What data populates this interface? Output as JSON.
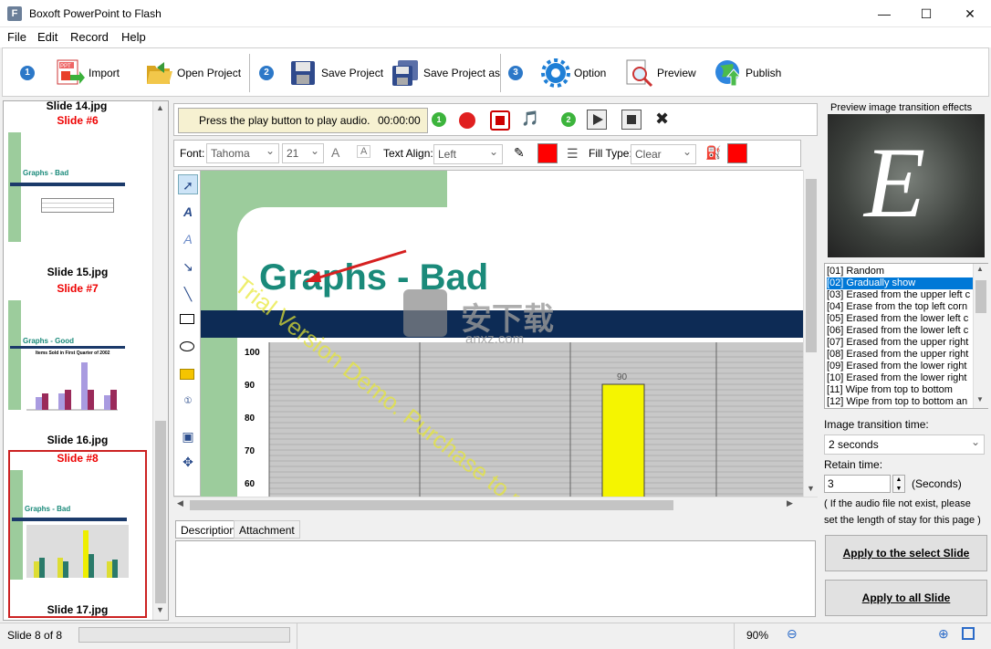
{
  "window": {
    "title": "Boxoft PowerPoint to Flash",
    "icon_letter": "F"
  },
  "menu": [
    "File",
    "Edit",
    "Record",
    "Help"
  ],
  "toolbar": {
    "steps": [
      "1",
      "2",
      "3"
    ],
    "import": "Import",
    "open_project": "Open Project",
    "save_project": "Save Project",
    "save_project_as": "Save Project as",
    "option": "Option",
    "preview": "Preview",
    "publish": "Publish"
  },
  "slides": [
    {
      "file_above": "Slide 14.jpg",
      "label": "Slide #6",
      "title": "Graphs - Bad",
      "file": "Slide 15.jpg"
    },
    {
      "label": "Slide #7",
      "title": "Graphs - Good",
      "subtitle": "Items Sold in First Quarter of 2002",
      "file": "Slide 16.jpg"
    },
    {
      "label": "Slide #8",
      "title": "Graphs - Bad",
      "file": "Slide 17.jpg",
      "selected": true
    }
  ],
  "audio": {
    "message": "Press the play button to play audio.",
    "time": "00:00:00",
    "step_a": "1",
    "step_b": "2"
  },
  "format": {
    "font_label": "Font:",
    "font_value": "Tahoma",
    "size_value": "21",
    "align_label": "Text Align:",
    "align_value": "Left",
    "fill_label": "Fill Type:",
    "fill_value": "Clear",
    "color": "#ff0000"
  },
  "canvas": {
    "slide_title": "Graphs - Bad",
    "watermark": "Trial Version Demo. Purchase to remove",
    "logo_text": "安下载",
    "logo_sub": "anxz.com",
    "y_ticks": [
      "100",
      "90",
      "80",
      "70",
      "60"
    ],
    "bar_value_label": "90",
    "bar_value": 90
  },
  "desc_tabs": [
    "Description",
    "Attachment"
  ],
  "right": {
    "preview_title": "Preview image transition effects",
    "preview_letter": "E",
    "effects": [
      "[01] Random",
      "[02] Gradually show",
      "[03] Erased from the upper left c",
      "[04] Erase from the top left corn",
      "[05] Erased from the lower left c",
      "[06] Erased from the lower left c",
      "[07] Erased from the upper right",
      "[08] Erased from the upper right",
      "[09] Erased from the lower right",
      "[10] Erased from the lower right",
      "[11] Wipe from top to bottom",
      "[12] Wipe from top to bottom an"
    ],
    "selected_effect": 1,
    "transition_label": "Image transition time:",
    "transition_value": "2 seconds",
    "retain_label": "Retain time:",
    "retain_value": "3",
    "retain_unit": "(Seconds)",
    "note_line1": "( If the audio file not exist, please",
    "note_line2": "set the length of stay for this page )",
    "apply_select": "Apply to the select Slide",
    "apply_all": "Apply to all Slide"
  },
  "status": {
    "slide": "Slide 8 of 8",
    "zoom": "90%"
  }
}
